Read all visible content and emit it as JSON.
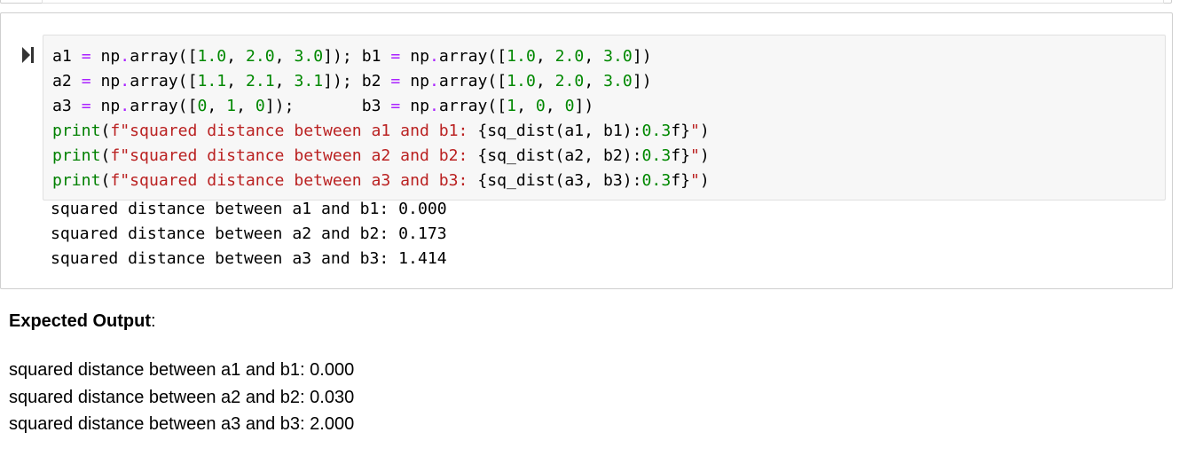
{
  "code_cell": {
    "run_icon": "run-cell-icon",
    "lines": [
      [
        {
          "t": "a1",
          "c": "n"
        },
        {
          "t": " ",
          "c": "n"
        },
        {
          "t": "=",
          "c": "o"
        },
        {
          "t": " np",
          "c": "n"
        },
        {
          "t": ".",
          "c": "o"
        },
        {
          "t": "array([",
          "c": "n"
        },
        {
          "t": "1.0",
          "c": "num"
        },
        {
          "t": ", ",
          "c": "n"
        },
        {
          "t": "2.0",
          "c": "num"
        },
        {
          "t": ", ",
          "c": "n"
        },
        {
          "t": "3.0",
          "c": "num"
        },
        {
          "t": "]); b1 ",
          "c": "n"
        },
        {
          "t": "=",
          "c": "o"
        },
        {
          "t": " np",
          "c": "n"
        },
        {
          "t": ".",
          "c": "o"
        },
        {
          "t": "array([",
          "c": "n"
        },
        {
          "t": "1.0",
          "c": "num"
        },
        {
          "t": ", ",
          "c": "n"
        },
        {
          "t": "2.0",
          "c": "num"
        },
        {
          "t": ", ",
          "c": "n"
        },
        {
          "t": "3.0",
          "c": "num"
        },
        {
          "t": "])",
          "c": "n"
        }
      ],
      [
        {
          "t": "a2",
          "c": "n"
        },
        {
          "t": " ",
          "c": "n"
        },
        {
          "t": "=",
          "c": "o"
        },
        {
          "t": " np",
          "c": "n"
        },
        {
          "t": ".",
          "c": "o"
        },
        {
          "t": "array([",
          "c": "n"
        },
        {
          "t": "1.1",
          "c": "num"
        },
        {
          "t": ", ",
          "c": "n"
        },
        {
          "t": "2.1",
          "c": "num"
        },
        {
          "t": ", ",
          "c": "n"
        },
        {
          "t": "3.1",
          "c": "num"
        },
        {
          "t": "]); b2 ",
          "c": "n"
        },
        {
          "t": "=",
          "c": "o"
        },
        {
          "t": " np",
          "c": "n"
        },
        {
          "t": ".",
          "c": "o"
        },
        {
          "t": "array([",
          "c": "n"
        },
        {
          "t": "1.0",
          "c": "num"
        },
        {
          "t": ", ",
          "c": "n"
        },
        {
          "t": "2.0",
          "c": "num"
        },
        {
          "t": ", ",
          "c": "n"
        },
        {
          "t": "3.0",
          "c": "num"
        },
        {
          "t": "])",
          "c": "n"
        }
      ],
      [
        {
          "t": "a3",
          "c": "n"
        },
        {
          "t": " ",
          "c": "n"
        },
        {
          "t": "=",
          "c": "o"
        },
        {
          "t": " np",
          "c": "n"
        },
        {
          "t": ".",
          "c": "o"
        },
        {
          "t": "array([",
          "c": "n"
        },
        {
          "t": "0",
          "c": "num"
        },
        {
          "t": ", ",
          "c": "n"
        },
        {
          "t": "1",
          "c": "num"
        },
        {
          "t": ", ",
          "c": "n"
        },
        {
          "t": "0",
          "c": "num"
        },
        {
          "t": "]);       b3 ",
          "c": "n"
        },
        {
          "t": "=",
          "c": "o"
        },
        {
          "t": " np",
          "c": "n"
        },
        {
          "t": ".",
          "c": "o"
        },
        {
          "t": "array([",
          "c": "n"
        },
        {
          "t": "1",
          "c": "num"
        },
        {
          "t": ", ",
          "c": "n"
        },
        {
          "t": "0",
          "c": "num"
        },
        {
          "t": ", ",
          "c": "n"
        },
        {
          "t": "0",
          "c": "num"
        },
        {
          "t": "])",
          "c": "n"
        }
      ],
      [
        {
          "t": "print",
          "c": "kw"
        },
        {
          "t": "(",
          "c": "n"
        },
        {
          "t": "f\"squared distance between a1 and b1: ",
          "c": "str"
        },
        {
          "t": "{sq_dist(a1, b1)",
          "c": "n"
        },
        {
          "t": ":",
          "c": "n"
        },
        {
          "t": "0.3",
          "c": "num"
        },
        {
          "t": "f}",
          "c": "n"
        },
        {
          "t": "\"",
          "c": "str"
        },
        {
          "t": ")",
          "c": "n"
        }
      ],
      [
        {
          "t": "print",
          "c": "kw"
        },
        {
          "t": "(",
          "c": "n"
        },
        {
          "t": "f\"squared distance between a2 and b2: ",
          "c": "str"
        },
        {
          "t": "{sq_dist(a2, b2)",
          "c": "n"
        },
        {
          "t": ":",
          "c": "n"
        },
        {
          "t": "0.3",
          "c": "num"
        },
        {
          "t": "f}",
          "c": "n"
        },
        {
          "t": "\"",
          "c": "str"
        },
        {
          "t": ")",
          "c": "n"
        }
      ],
      [
        {
          "t": "print",
          "c": "kw"
        },
        {
          "t": "(",
          "c": "n"
        },
        {
          "t": "f\"squared distance between a3 and b3: ",
          "c": "str"
        },
        {
          "t": "{sq_dist(a3, b3)",
          "c": "n"
        },
        {
          "t": ":",
          "c": "n"
        },
        {
          "t": "0.3",
          "c": "num"
        },
        {
          "t": "f}",
          "c": "n"
        },
        {
          "t": "\"",
          "c": "str"
        },
        {
          "t": ")",
          "c": "n"
        }
      ]
    ]
  },
  "output": {
    "lines": [
      "squared distance between a1 and b1: 0.000",
      "squared distance between a2 and b2: 0.173",
      "squared distance between a3 and b3: 1.414"
    ]
  },
  "markdown": {
    "heading_bold": "Expected Output",
    "heading_suffix": ":",
    "lines": [
      "squared distance between a1 and b1: 0.000",
      "squared distance between a2 and b2: 0.030",
      "squared distance between a3 and b3: 2.000"
    ]
  },
  "colors": {
    "n": "#000000",
    "o": "#aa22ff",
    "num": "#008800",
    "kw": "#008000",
    "str": "#ba2121",
    "input_bg": "#f7f7f7",
    "cell_border": "#cfcfcf"
  }
}
